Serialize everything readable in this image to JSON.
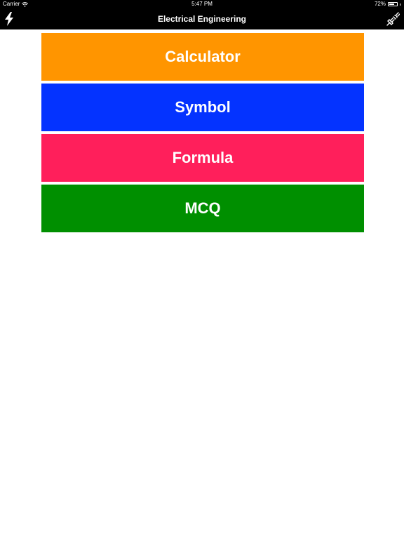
{
  "status": {
    "carrier": "Carrier",
    "time": "5:47 PM",
    "battery": "72%",
    "battery_level": 0.72
  },
  "nav": {
    "title": "Electrical Engineering",
    "left_icon": "lightning-icon",
    "right_icon": "plug-icon"
  },
  "menu": {
    "items": [
      {
        "label": "Calculator",
        "color": "#ff9500"
      },
      {
        "label": "Symbol",
        "color": "#0433ff"
      },
      {
        "label": "Formula",
        "color": "#ff1f5b"
      },
      {
        "label": "MCQ",
        "color": "#008f00"
      }
    ]
  }
}
